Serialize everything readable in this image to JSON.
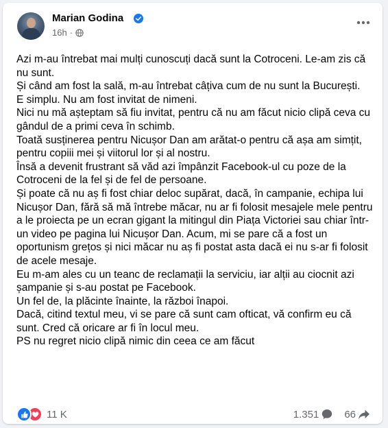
{
  "post": {
    "author": "Marian Godina",
    "time": "16h",
    "paragraphs": [
      "Azi m-au întrebat mai mulți cunoscuți dacă sunt la Cotroceni. Le-am zis că nu sunt.",
      "Și când am fost la sală, m-au întrebat câțiva cum de nu sunt la București.",
      "E simplu. Nu am fost invitat de nimeni.",
      "Nici nu mă așteptam să fiu invitat, pentru că nu am făcut nicio clipă ceva cu gândul de a primi ceva în schimb.",
      "Toată susținerea pentru Nicușor Dan am arătat-o pentru că așa am simțit, pentru copiii mei și viitorul lor și al nostru.",
      "Însă a devenit frustrant să văd azi împânzit Facebook-ul cu poze de la Cotroceni de la fel și de fel de persoane.",
      "Și poate că nu aș fi fost chiar deloc supărat, dacă, în campanie, echipa lui Nicușor Dan, fără să mă întrebe măcar, nu ar fi folosit mesajele mele pentru a le proiecta pe un ecran gigant la mitingul din Piața Victoriei sau chiar într-un video pe pagina lui Nicușor Dan. Acum, mi se pare că a fost un oportunism grețos și nici măcar nu aș fi postat asta dacă ei nu s-ar fi folosit de acele mesaje.",
      "Eu m-am ales cu un teanc de reclamații la serviciu, iar alții au ciocnit azi șampanie și s-au postat pe Facebook.",
      "Un fel de, la plăcinte înainte, la război înapoi.",
      "Dacă, citind textul meu, vi se pare că sunt cam ofticat, vă confirm eu că sunt. Cred că oricare ar fi în locul meu.",
      "PS nu regret nicio clipă nimic din ceea ce am făcut"
    ]
  },
  "stats": {
    "reactions": "11 K",
    "comments": "1.351",
    "shares": "66"
  },
  "icons": {
    "verified": "verified-badge-icon",
    "privacy": "globe-icon",
    "more": "more-options-icon",
    "like": "like-reaction-icon",
    "love": "love-reaction-icon",
    "comment": "comment-icon",
    "share": "share-icon"
  },
  "colors": {
    "verified": "#1877f2",
    "like": "#1877f2",
    "love": "#f33e58",
    "secondary_text": "#65676b"
  }
}
